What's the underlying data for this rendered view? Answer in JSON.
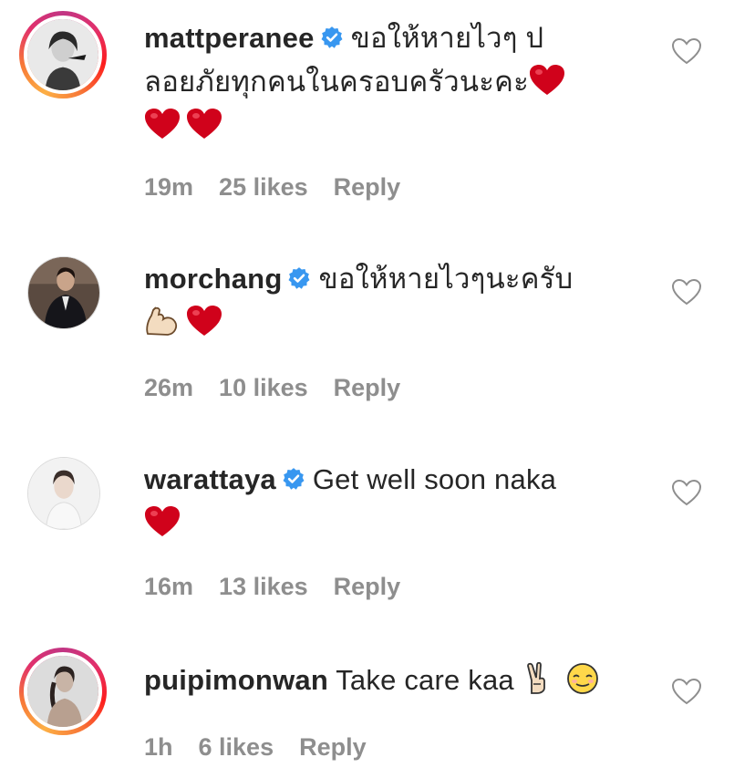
{
  "comments": [
    {
      "username": "mattperanee",
      "text": "ขอให้หายไวๆ ปลอยภัยทุกคนในครอบครัวนะคะ",
      "text_line1": "ขอให้หายไวๆ ป",
      "text_line2": "ลอยภัยทุกคนในครอบครัวนะคะ",
      "emojis": [
        "red-heart",
        "red-heart",
        "red-heart"
      ],
      "time": "19m",
      "likes": "25 likes",
      "reply": "Reply",
      "verified": true,
      "story_ring": true
    },
    {
      "username": "morchang",
      "text": "ขอให้หายไวๆนะครับ",
      "emojis": [
        "flexed-biceps",
        "red-heart"
      ],
      "time": "26m",
      "likes": "10 likes",
      "reply": "Reply",
      "verified": true,
      "story_ring": false
    },
    {
      "username": "warattaya",
      "text": "Get well soon naka",
      "emojis": [
        "red-heart"
      ],
      "time": "16m",
      "likes": "13 likes",
      "reply": "Reply",
      "verified": true,
      "story_ring": false
    },
    {
      "username": "puipimonwan",
      "text": "Take care kaa",
      "emojis": [
        "victory-hand",
        "relieved-face"
      ],
      "time": "1h",
      "likes": "6 likes",
      "reply": "Reply",
      "verified": false,
      "story_ring": true
    }
  ],
  "colors": {
    "text": "#262626",
    "meta": "#8e8e8e",
    "verified": "#3897f0",
    "heart": "#d0021b"
  },
  "icons": {
    "like": "heart-outline-icon",
    "verified": "verified-badge-icon"
  }
}
